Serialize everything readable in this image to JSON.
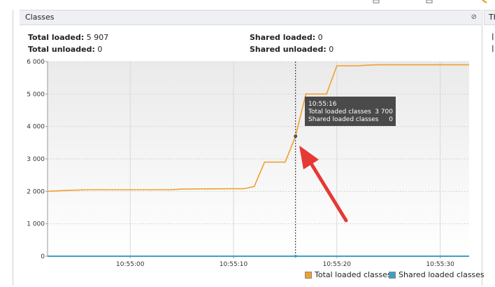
{
  "panel": {
    "title": "Classes",
    "close_glyph": "⊘",
    "next_tab_label": "Th"
  },
  "stats": {
    "total_loaded_label": "Total loaded:",
    "total_loaded_value": "5 907",
    "total_unloaded_label": "Total unloaded:",
    "total_unloaded_value": "0",
    "shared_loaded_label": "Shared loaded:",
    "shared_loaded_value": "0",
    "shared_unloaded_label": "Shared unloaded:",
    "shared_unloaded_value": "0"
  },
  "tooltip": {
    "time": "10:55:16",
    "total_label": "Total loaded classes",
    "total_value": "3 700",
    "shared_label": "Shared loaded classes",
    "shared_value": "0"
  },
  "colors": {
    "total_series": "#f0a030",
    "shared_series": "#3aa0c8",
    "arrow": "#e53935",
    "tooltip_bg": "#4a4a4a"
  },
  "chart_data": {
    "type": "line",
    "y_ticks": [
      "0",
      "1 000",
      "2 000",
      "3 000",
      "4 000",
      "5 000",
      "6 000"
    ],
    "x_ticks": [
      "10:55:00",
      "10:55:10",
      "10:55:20",
      "10:55:30"
    ],
    "x_tick_seconds": [
      0,
      10,
      20,
      30
    ],
    "xlim": [
      -8,
      32.8
    ],
    "ylim": [
      0,
      6000
    ],
    "grid": true,
    "cursor_x": 16,
    "series": [
      {
        "name": "Total loaded classes",
        "x": [
          -8,
          -6,
          -4,
          0,
          4,
          5,
          10,
          11,
          12,
          13,
          15,
          16,
          17,
          19,
          20,
          21,
          22,
          23,
          24,
          26,
          28,
          30,
          32.8
        ],
        "y": [
          2000,
          2030,
          2050,
          2050,
          2050,
          2070,
          2080,
          2080,
          2150,
          2900,
          2900,
          3700,
          5000,
          5000,
          5870,
          5870,
          5870,
          5890,
          5900,
          5900,
          5900,
          5900,
          5900
        ]
      },
      {
        "name": "Shared loaded classes",
        "x": [
          -8,
          32.8
        ],
        "y": [
          0,
          0
        ]
      }
    ]
  }
}
